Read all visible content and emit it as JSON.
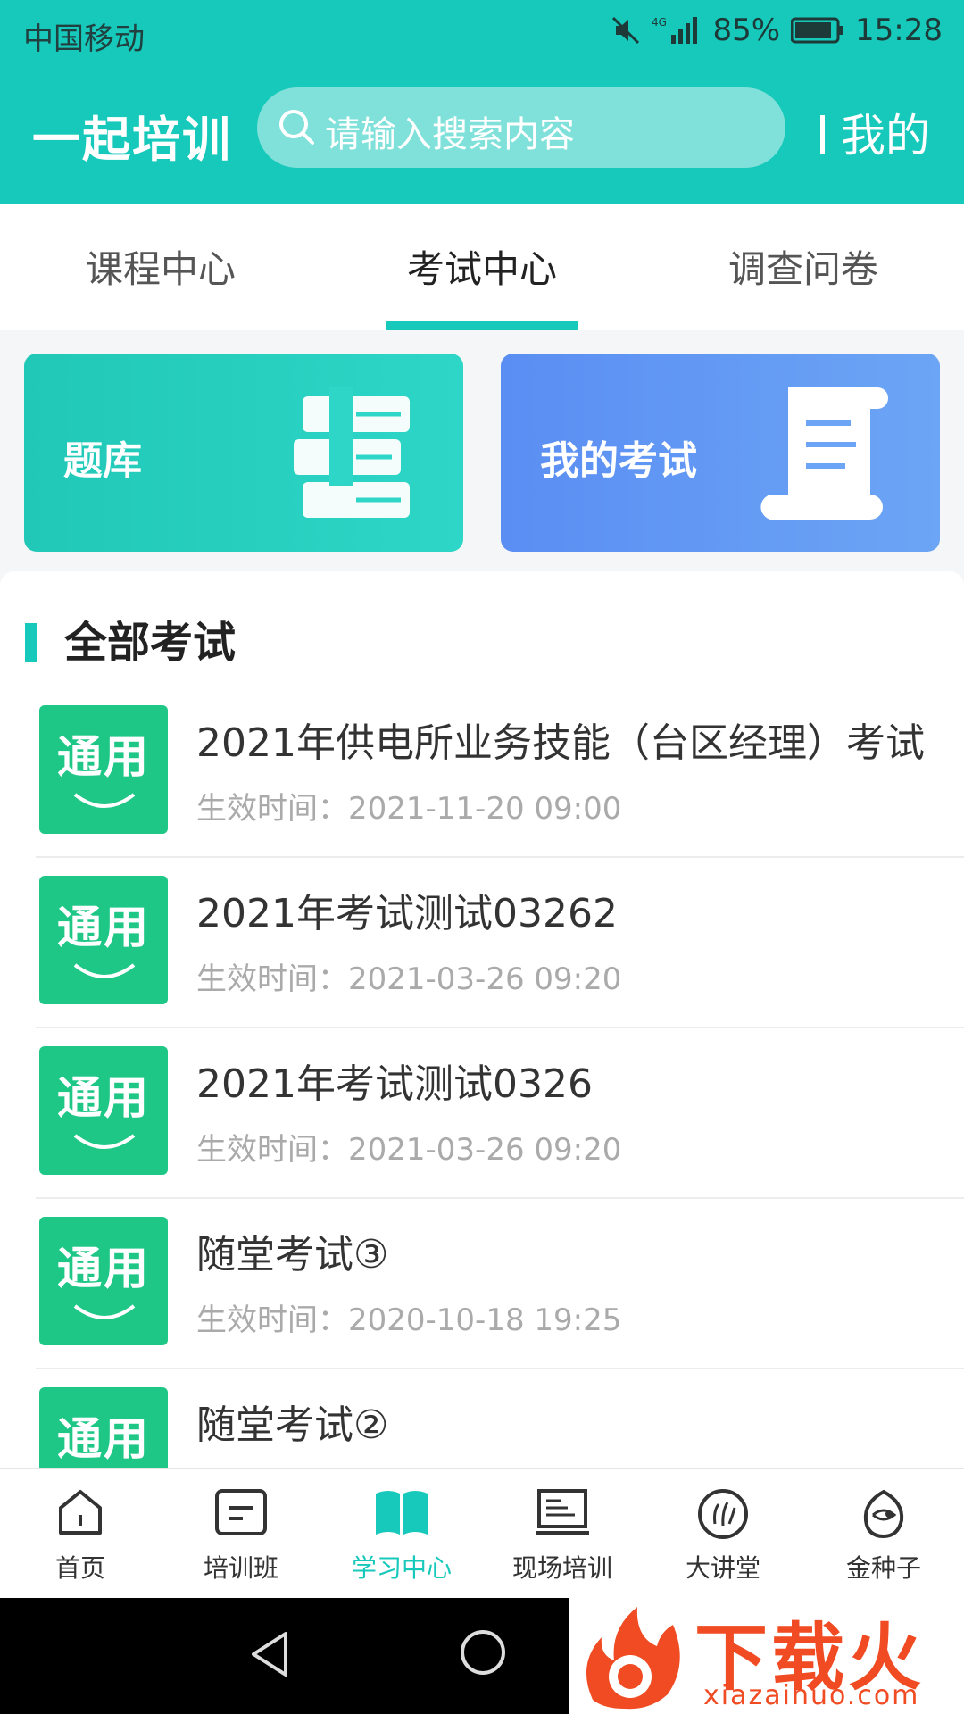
{
  "status_bar": {
    "carrier": "中国移动",
    "network": "4G",
    "battery": "85%",
    "time": "15:28"
  },
  "header": {
    "app_title": "一起培训",
    "search_placeholder": "请输入搜索内容",
    "mine_label": "我的"
  },
  "tabs": [
    {
      "label": "课程中心",
      "active": false
    },
    {
      "label": "考试中心",
      "active": true
    },
    {
      "label": "调查问卷",
      "active": false
    }
  ],
  "cards": {
    "question_bank": "题库",
    "my_exams": "我的考试"
  },
  "section_title": "全部考试",
  "exams": [
    {
      "badge": "通用",
      "title": "2021年供电所业务技能（台区经理）考试",
      "time": "生效时间：2021-11-20 09:00"
    },
    {
      "badge": "通用",
      "title": "2021年考试测试03262",
      "time": "生效时间：2021-03-26 09:20"
    },
    {
      "badge": "通用",
      "title": "2021年考试测试0326",
      "time": "生效时间：2021-03-26 09:20"
    },
    {
      "badge": "通用",
      "title": "随堂考试③",
      "time": "生效时间：2020-10-18 19:25"
    },
    {
      "badge": "通用",
      "title": "随堂考试②",
      "time": ""
    }
  ],
  "bottom_nav": [
    {
      "label": "首页",
      "icon": "home-icon"
    },
    {
      "label": "培训班",
      "icon": "class-icon"
    },
    {
      "label": "学习中心",
      "icon": "book-icon",
      "active": true
    },
    {
      "label": "现场培训",
      "icon": "board-icon"
    },
    {
      "label": "大讲堂",
      "icon": "lecture-icon"
    },
    {
      "label": "金种子",
      "icon": "seed-icon"
    }
  ],
  "watermark": {
    "text": "下载火",
    "url": "xiazaihuo.com"
  },
  "colors": {
    "primary": "#17c9bb",
    "badge": "#1ec786",
    "blue_card": "#5a8ef3"
  }
}
